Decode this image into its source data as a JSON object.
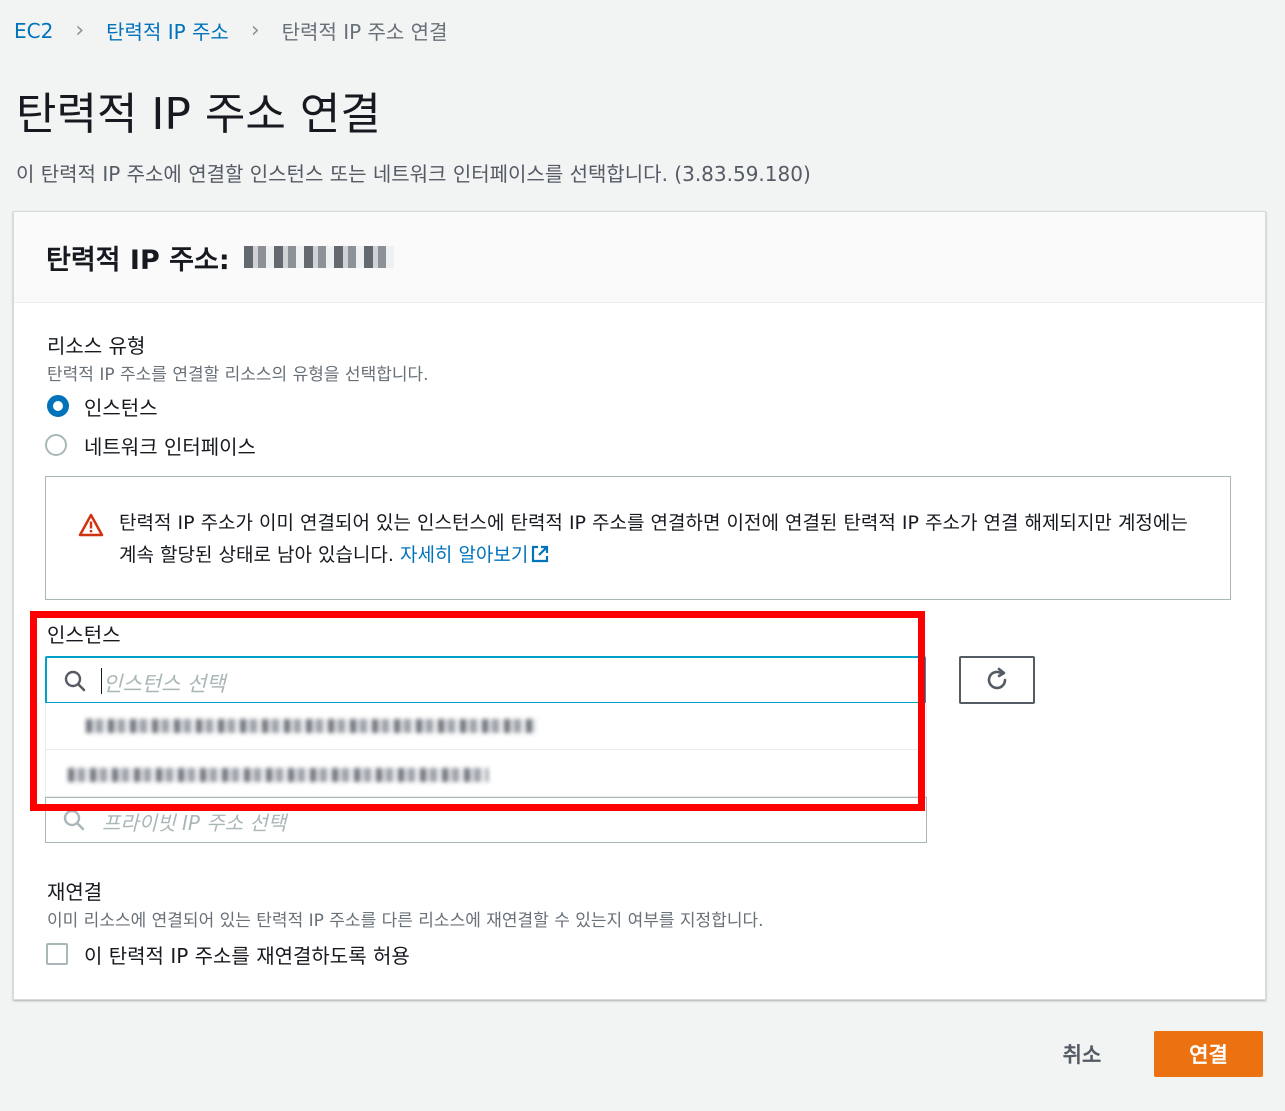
{
  "breadcrumb": {
    "items": [
      "EC2",
      "탄력적 IP 주소",
      "탄력적 IP 주소 연결"
    ]
  },
  "page": {
    "title": "탄력적 IP 주소 연결",
    "description": "이 탄력적 IP 주소에 연결할 인스턴스 또는 네트워크 인터페이스를 선택합니다. (3.83.59.180)"
  },
  "panel": {
    "title": "탄력적 IP 주소:"
  },
  "resource_type": {
    "label": "리소스 유형",
    "description": "탄력적 IP 주소를 연결할 리소스의 유형을 선택합니다.",
    "options": [
      "인스턴스",
      "네트워크 인터페이스"
    ],
    "selected": "인스턴스"
  },
  "alert": {
    "text": "탄력적 IP 주소가 이미 연결되어 있는 인스턴스에 탄력적 IP 주소를 연결하면 이전에 연결된 탄력적 IP 주소가 연결 해제되지만 계정에는 계속 할당된 상태로 남아 있습니다.",
    "link": "자세히 알아보기"
  },
  "instance": {
    "label": "인스턴스",
    "placeholder": "인스턴스 선택"
  },
  "private_ip": {
    "placeholder": "프라이빗 IP 주소 선택"
  },
  "reassociation": {
    "label": "재연결",
    "description": "이미 리소스에 연결되어 있는 탄력적 IP 주소를 다른 리소스에 재연결할 수 있는지 여부를 지정합니다.",
    "checkbox_label": "이 탄력적 IP 주소를 재연결하도록 허용",
    "checked": false
  },
  "actions": {
    "cancel": "취소",
    "submit": "연결"
  },
  "colors": {
    "primary": "#ec7211",
    "link": "#0073bb",
    "focus": "#00a1c9",
    "warning": "#d13212",
    "highlight": "#ff0000"
  }
}
